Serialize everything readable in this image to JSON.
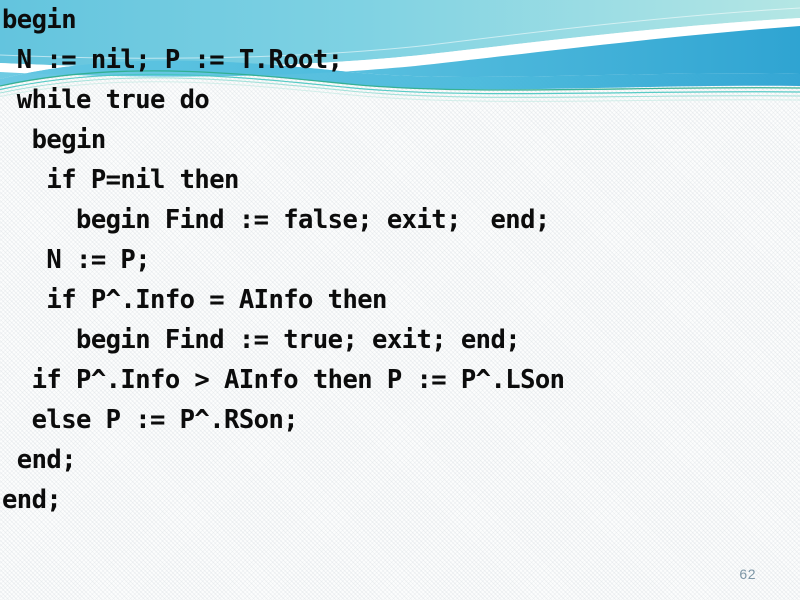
{
  "slide": {
    "kind": "presentation-slide",
    "page_number": "62",
    "background_color": "#fbfcfc",
    "text_color": "#0c0c0c",
    "page_number_color": "#7d96a6"
  },
  "decoration": {
    "banner_name": "teal-wave-banner",
    "colors": {
      "wave_upper_left": "#6ec9e0",
      "wave_upper_right": "#a9e2e2",
      "wave_lower_left": "#63c6e2",
      "wave_lower_right": "#35a8d4",
      "accent_line_green": "#2fae8e",
      "accent_line_teal": "#46c7c0",
      "accent_line_pale": "#8fdcd2",
      "gap_white": "#ffffff"
    }
  },
  "code": {
    "language": "pascal",
    "lines": [
      "begin",
      " N := nil; P := T.Root;",
      " while true do",
      "  begin",
      "   if P=nil then",
      "     begin Find := false; exit;  end;",
      "   N := P;",
      "   if P^.Info = AInfo then",
      "     begin Find := true; exit; end;",
      "  if P^.Info > AInfo then P := P^.LSon",
      "  else P := P^.RSon;",
      " end;",
      "end;"
    ]
  }
}
